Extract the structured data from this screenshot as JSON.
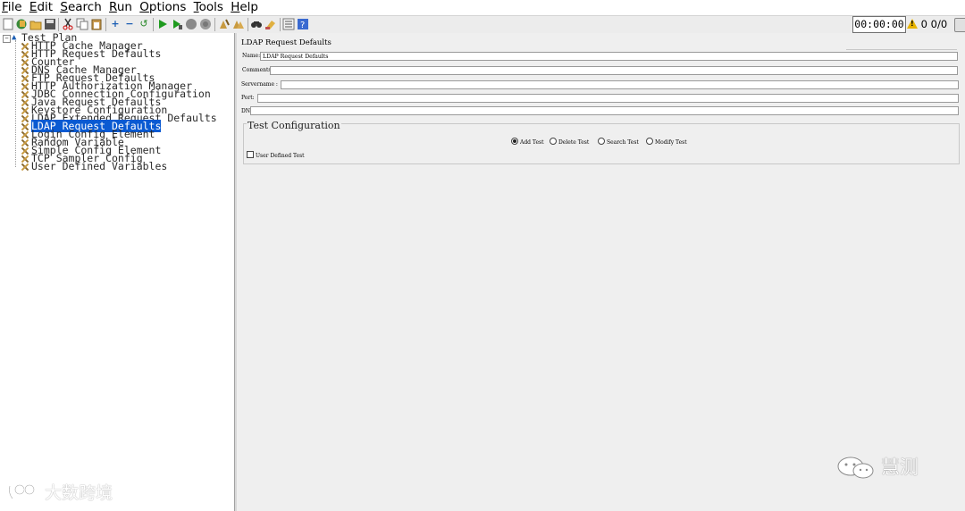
{
  "menu": [
    "File",
    "Edit",
    "Search",
    "Run",
    "Options",
    "Tools",
    "Help"
  ],
  "toolbar": {
    "icons": [
      "new-icon",
      "templates-icon",
      "open-icon",
      "save-icon",
      "cut-icon",
      "copy-icon",
      "paste-icon",
      "expand-icon",
      "collapse-icon",
      "toggle-icon",
      "start-icon",
      "start-no-pause-icon",
      "stop-icon",
      "shutdown-icon",
      "clear-icon",
      "clear-all-icon",
      "search-icon",
      "reset-search-icon",
      "function-helper-icon",
      "help-icon"
    ],
    "timer": "00:00:00",
    "warning_count": "0",
    "threads": "0/0"
  },
  "tree": {
    "root": "Test Plan",
    "items": [
      "HTTP Cache Manager",
      "HTTP Request Defaults",
      "Counter",
      "DNS Cache Manager",
      "FTP Request Defaults",
      "HTTP Authorization Manager",
      "JDBC Connection Configuration",
      "Java Request Defaults",
      "Keystore Configuration",
      "LDAP Extended Request Defaults",
      "LDAP Request Defaults",
      "Login Config Element",
      "Random Variable",
      "Simple Config Element",
      "TCP Sampler Config",
      "User Defined Variables"
    ],
    "selected_index": 10
  },
  "panel": {
    "title": "LDAP Request Defaults",
    "name_label": "Name:",
    "name_value": "LDAP Request Defaults",
    "comments_label": "Comments:",
    "comments_value": "",
    "servername_label": "Servername :",
    "servername_value": "",
    "port_label": "Port:",
    "port_value": "",
    "dn_label": "DN",
    "dn_value": "",
    "test_config": {
      "legend": "Test Configuration",
      "radios": [
        "Add Test",
        "Delete Test",
        "Search Test",
        "Modify Test"
      ],
      "selected": "Add Test",
      "user_defined_label": "User Defined Test"
    }
  },
  "watermarks": {
    "left": "大数跨境",
    "right": "慧测"
  }
}
